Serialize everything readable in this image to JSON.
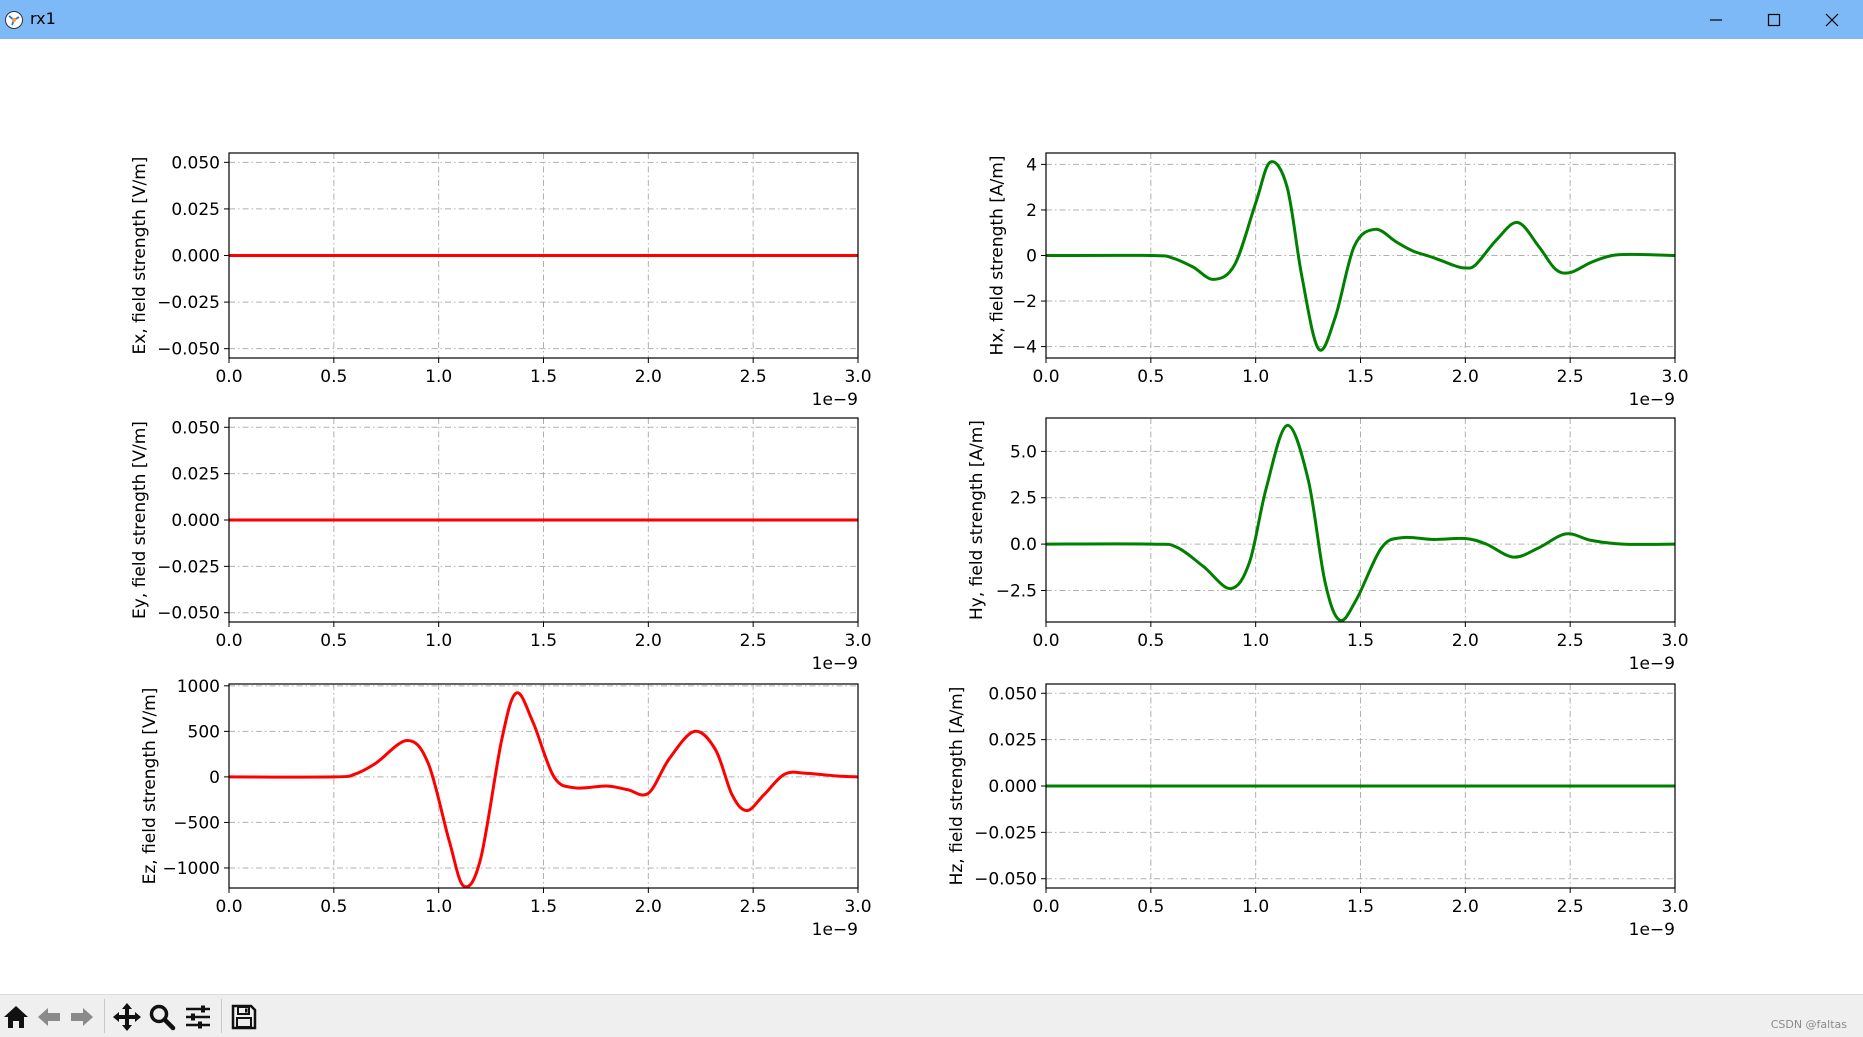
{
  "window": {
    "title": "rx1"
  },
  "colors": {
    "red": "#ff0000",
    "green": "#008000",
    "titlebar": "#7db8f7"
  },
  "toolbar": {
    "tools": [
      "home-icon",
      "back-arrow-icon",
      "forward-arrow-icon",
      "pan-move-icon",
      "zoom-icon",
      "configure-subplots-icon",
      "save-icon"
    ]
  },
  "watermark": "CSDN @faltas",
  "chart_data": [
    {
      "type": "line",
      "ylabel": "Ex, field strength [V/m]",
      "xlim": [
        0,
        3.0
      ],
      "ylim": [
        -0.055,
        0.055
      ],
      "xticks": [
        "0.0",
        "0.5",
        "1.0",
        "1.5",
        "2.0",
        "2.5",
        "3.0"
      ],
      "yticks": [
        0.05,
        0.025,
        0,
        -0.025,
        -0.05
      ],
      "yticklabels": [
        "0.050",
        "0.025",
        "0.000",
        "−0.025",
        "−0.050"
      ],
      "offset_text": "1e−9",
      "grid": true,
      "color": "#ff0000",
      "x": [
        0,
        3.0
      ],
      "y": [
        0,
        0
      ]
    },
    {
      "type": "line",
      "ylabel": "Hx, field strength [A/m]",
      "xlim": [
        0,
        3.0
      ],
      "ylim": [
        -4.5,
        4.5
      ],
      "xticks": [
        "0.0",
        "0.5",
        "1.0",
        "1.5",
        "2.0",
        "2.5",
        "3.0"
      ],
      "yticks": [
        4,
        2,
        0,
        -2,
        -4
      ],
      "yticklabels": [
        "4",
        "2",
        "0",
        "−2",
        "−4"
      ],
      "offset_text": "1e−9",
      "grid": true,
      "color": "#008000",
      "x": [
        0,
        0.5,
        0.6,
        0.7,
        0.8,
        0.9,
        1.0,
        1.07,
        1.15,
        1.22,
        1.3,
        1.38,
        1.47,
        1.57,
        1.67,
        1.75,
        1.85,
        1.95,
        2.0,
        2.05,
        2.15,
        2.25,
        2.35,
        2.43,
        2.5,
        2.6,
        2.7,
        2.8,
        3.0
      ],
      "y": [
        0,
        0,
        -0.1,
        -0.5,
        -1.05,
        -0.4,
        2.3,
        4.1,
        3.0,
        -0.9,
        -4.1,
        -2.7,
        0.4,
        1.15,
        0.6,
        0.2,
        -0.1,
        -0.45,
        -0.55,
        -0.4,
        0.7,
        1.45,
        0.4,
        -0.6,
        -0.75,
        -0.3,
        0,
        0.05,
        0
      ]
    },
    {
      "type": "line",
      "ylabel": "Ey, field strength [V/m]",
      "xlim": [
        0,
        3.0
      ],
      "ylim": [
        -0.055,
        0.055
      ],
      "xticks": [
        "0.0",
        "0.5",
        "1.0",
        "1.5",
        "2.0",
        "2.5",
        "3.0"
      ],
      "yticks": [
        0.05,
        0.025,
        0,
        -0.025,
        -0.05
      ],
      "yticklabels": [
        "0.050",
        "0.025",
        "0.000",
        "−0.025",
        "−0.050"
      ],
      "offset_text": "1e−9",
      "grid": true,
      "color": "#ff0000",
      "x": [
        0,
        3.0
      ],
      "y": [
        0,
        0
      ]
    },
    {
      "type": "line",
      "ylabel": "Hy, field strength [A/m]",
      "xlim": [
        0,
        3.0
      ],
      "ylim": [
        -4.2,
        6.8
      ],
      "xticks": [
        "0.0",
        "0.5",
        "1.0",
        "1.5",
        "2.0",
        "2.5",
        "3.0"
      ],
      "yticks": [
        5.0,
        2.5,
        0,
        -2.5
      ],
      "yticklabels": [
        "5.0",
        "2.5",
        "0.0",
        "−2.5"
      ],
      "offset_text": "1e−9",
      "grid": true,
      "color": "#008000",
      "x": [
        0,
        0.5,
        0.62,
        0.75,
        0.88,
        0.97,
        1.05,
        1.15,
        1.25,
        1.33,
        1.4,
        1.48,
        1.6,
        1.7,
        1.85,
        2.0,
        2.1,
        2.23,
        2.35,
        2.48,
        2.6,
        2.75,
        3.0
      ],
      "y": [
        0,
        0,
        -0.15,
        -1.2,
        -2.4,
        -1.0,
        3.0,
        6.4,
        3.5,
        -2.0,
        -4.1,
        -3.0,
        -0.2,
        0.35,
        0.25,
        0.3,
        0.0,
        -0.7,
        -0.2,
        0.55,
        0.2,
        0.0,
        0
      ]
    },
    {
      "type": "line",
      "ylabel": "Ez, field strength [V/m]",
      "xlim": [
        0,
        3.0
      ],
      "ylim": [
        -1220,
        1020
      ],
      "xticks": [
        "0.0",
        "0.5",
        "1.0",
        "1.5",
        "2.0",
        "2.5",
        "3.0"
      ],
      "yticks": [
        1000,
        500,
        0,
        -500,
        -1000
      ],
      "yticklabels": [
        "1000",
        "500",
        "0",
        "−500",
        "−1000"
      ],
      "offset_text": "1e−9",
      "grid": true,
      "color": "#ff0000",
      "x": [
        0,
        0.5,
        0.6,
        0.7,
        0.85,
        0.95,
        1.05,
        1.12,
        1.2,
        1.3,
        1.37,
        1.45,
        1.55,
        1.65,
        1.8,
        1.9,
        2.0,
        2.1,
        2.22,
        2.32,
        2.4,
        2.47,
        2.55,
        2.65,
        2.75,
        2.9,
        3.0
      ],
      "y": [
        0,
        0,
        30,
        150,
        400,
        150,
        -700,
        -1200,
        -900,
        400,
        920,
        600,
        0,
        -120,
        -100,
        -140,
        -180,
        200,
        500,
        300,
        -200,
        -370,
        -200,
        30,
        40,
        10,
        0
      ]
    },
    {
      "type": "line",
      "ylabel": "Hz, field strength [A/m]",
      "xlim": [
        0,
        3.0
      ],
      "ylim": [
        -0.055,
        0.055
      ],
      "xticks": [
        "0.0",
        "0.5",
        "1.0",
        "1.5",
        "2.0",
        "2.5",
        "3.0"
      ],
      "yticks": [
        0.05,
        0.025,
        0,
        -0.025,
        -0.05
      ],
      "yticklabels": [
        "0.050",
        "0.025",
        "0.000",
        "−0.025",
        "−0.050"
      ],
      "offset_text": "1e−9",
      "grid": true,
      "color": "#008000",
      "x": [
        0,
        3.0
      ],
      "y": [
        0,
        0
      ]
    }
  ]
}
